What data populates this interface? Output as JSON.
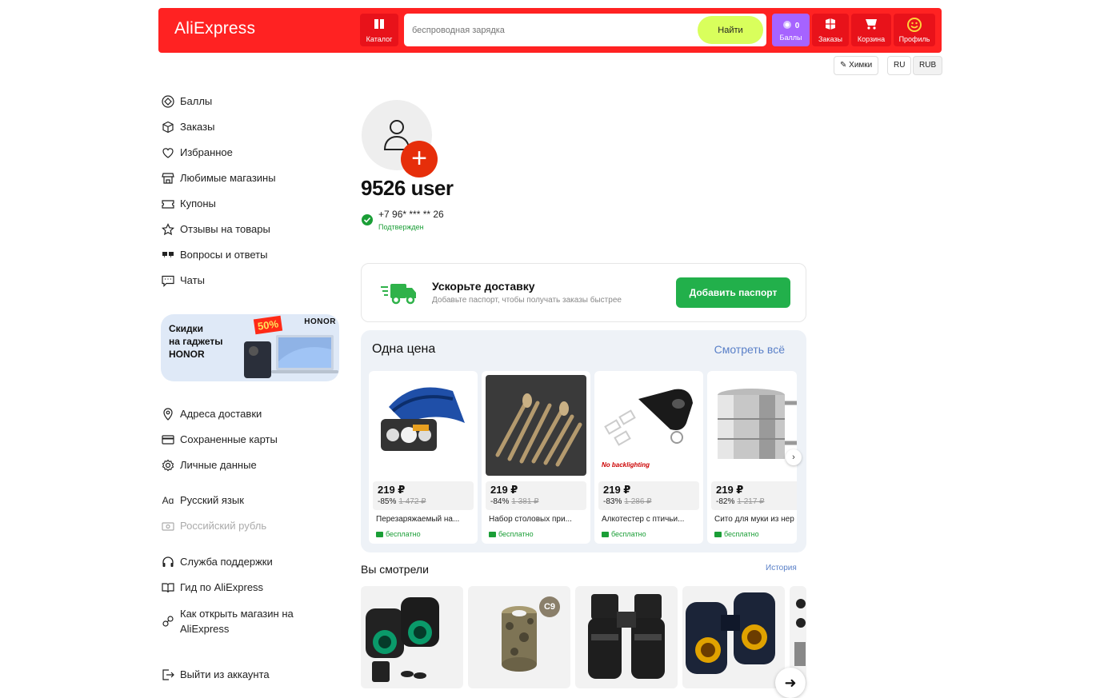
{
  "header": {
    "logo": "AliExpress",
    "catalog_label": "Каталог",
    "search_placeholder": "беспроводная зарядка",
    "search_button": "Найти",
    "bonus_count": "0",
    "bonus_label": "Баллы",
    "orders_label": "Заказы",
    "cart_label": "Корзина",
    "profile_label": "Профиль",
    "brand_color": "#ff2222"
  },
  "topbar": {
    "city": "Химки",
    "language": "RU",
    "currency": "RUB"
  },
  "sidebar": {
    "main_items": [
      {
        "label": "Баллы",
        "icon": "bonus-icon"
      },
      {
        "label": "Заказы",
        "icon": "box-icon"
      },
      {
        "label": "Избранное",
        "icon": "heart-icon"
      },
      {
        "label": "Любимые магазины",
        "icon": "store-icon"
      },
      {
        "label": "Купоны",
        "icon": "coupon-icon"
      },
      {
        "label": "Отзывы на товары",
        "icon": "star-icon"
      },
      {
        "label": "Вопросы и ответы",
        "icon": "quote-icon"
      },
      {
        "label": "Чаты",
        "icon": "chat-icon"
      }
    ],
    "promo": {
      "text": "Скидки\nна гаджеты\nHONOR",
      "brand": "HONOR",
      "badge": "50%"
    },
    "settings_items": [
      {
        "label": "Адреса доставки",
        "icon": "pin-icon"
      },
      {
        "label": "Сохраненные карты",
        "icon": "card-icon"
      },
      {
        "label": "Личные данные",
        "icon": "settings-icon"
      }
    ],
    "locale_items": [
      {
        "label": "Русский язык",
        "icon": "language-icon"
      },
      {
        "label": "Российский рубль",
        "icon": "currency-icon"
      }
    ],
    "help_items": [
      {
        "label": "Служба поддержки",
        "icon": "headphones-icon"
      },
      {
        "label": "Гид по AliExpress",
        "icon": "book-icon"
      },
      {
        "label": "Как открыть магазин на\nAliExpress",
        "icon": "link-icon"
      }
    ],
    "logout": {
      "label": "Выйти из аккаунта",
      "icon": "logout-icon"
    }
  },
  "profile": {
    "username": "9526 user",
    "phone": "+7 96* *** ** 26",
    "verified": "Подтвержден"
  },
  "delivery": {
    "title": "Ускорьте доставку",
    "subtitle": "Добавьте паспорт, чтобы получать заказы быстрее",
    "button": "Добавить паспорт"
  },
  "one_price": {
    "title": "Одна цена",
    "see_all": "Смотреть всё",
    "products": [
      {
        "price": "219 ₽",
        "discount": "-85%",
        "old_price": "1 472 ₽",
        "name": "Перезаряжаемый на...",
        "delivery": "бесплатно"
      },
      {
        "price": "219 ₽",
        "discount": "-84%",
        "old_price": "1 381 ₽",
        "name": "Набор столовых при...",
        "delivery": "бесплатно"
      },
      {
        "price": "219 ₽",
        "discount": "-83%",
        "old_price": "1 286 ₽",
        "name": "Алкотестер с птичьи...",
        "delivery": "бесплатно",
        "img_caption": "No backlighting"
      },
      {
        "price": "219 ₽",
        "discount": "-82%",
        "old_price": "1 217 ₽",
        "name": "Сито для муки из нер",
        "delivery": "бесплатно"
      }
    ]
  },
  "viewed": {
    "title": "Вы смотрели",
    "history": "История",
    "badge": "C9"
  }
}
